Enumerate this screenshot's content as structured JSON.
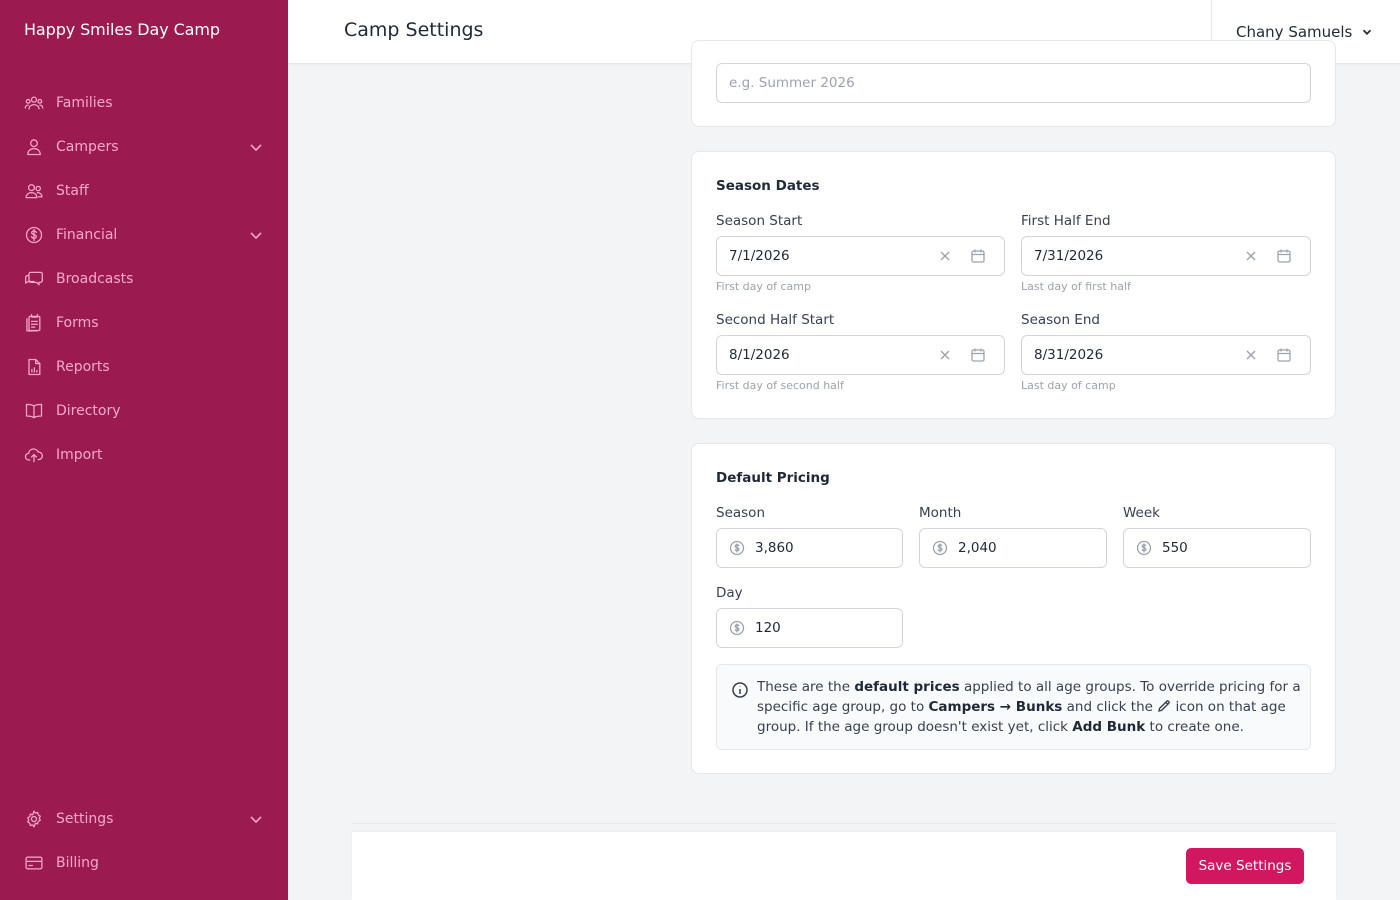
{
  "app": {
    "brand": "Happy Smiles Day Camp"
  },
  "sidebar": {
    "items": [
      {
        "label": "Families",
        "icon": "users-icon"
      },
      {
        "label": "Campers",
        "icon": "user-icon",
        "expandable": true
      },
      {
        "label": "Staff",
        "icon": "staff-icon"
      },
      {
        "label": "Financial",
        "icon": "dollar-circle-icon",
        "expandable": true
      },
      {
        "label": "Broadcasts",
        "icon": "chat-icon"
      },
      {
        "label": "Forms",
        "icon": "forms-icon"
      },
      {
        "label": "Reports",
        "icon": "report-icon"
      },
      {
        "label": "Directory",
        "icon": "book-icon"
      },
      {
        "label": "Import",
        "icon": "cloud-upload-icon"
      }
    ],
    "bottom_items": [
      {
        "label": "Settings",
        "icon": "gear-icon",
        "expandable": true
      },
      {
        "label": "Billing",
        "icon": "credit-card-icon"
      }
    ]
  },
  "header": {
    "title": "Camp Settings",
    "user_name": "Chany Samuels"
  },
  "season_name": {
    "placeholder": "e.g. Summer 2026"
  },
  "season_dates": {
    "title": "Season Dates",
    "season_start": {
      "label": "Season Start",
      "value": "7/1/2026",
      "hint": "First day of camp"
    },
    "first_half_end": {
      "label": "First Half End",
      "value": "7/31/2026",
      "hint": "Last day of first half"
    },
    "second_half_start": {
      "label": "Second Half Start",
      "value": "8/1/2026",
      "hint": "First day of second half"
    },
    "season_end": {
      "label": "Season End",
      "value": "8/31/2026",
      "hint": "Last day of camp"
    }
  },
  "pricing": {
    "title": "Default Pricing",
    "season": {
      "label": "Season",
      "value": "3,860"
    },
    "month": {
      "label": "Month",
      "value": "2,040"
    },
    "week": {
      "label": "Week",
      "value": "550"
    },
    "day": {
      "label": "Day",
      "value": "120"
    },
    "info": {
      "t1": "These are the ",
      "b1": "default prices",
      "t2": " applied to all age groups. To override pricing for a specific age group, go to ",
      "b2": "Campers → Bunks",
      "t3": " and click the ",
      "t4": " icon on that age group. If the age group doesn't exist yet, click ",
      "b3": "Add Bunk",
      "t5": " to create one."
    }
  },
  "footer": {
    "save_label": "Save Settings"
  },
  "colors": {
    "sidebar_bg": "#9b1b50",
    "accent": "#d1175f",
    "nav_text": "#f7a8cb"
  }
}
